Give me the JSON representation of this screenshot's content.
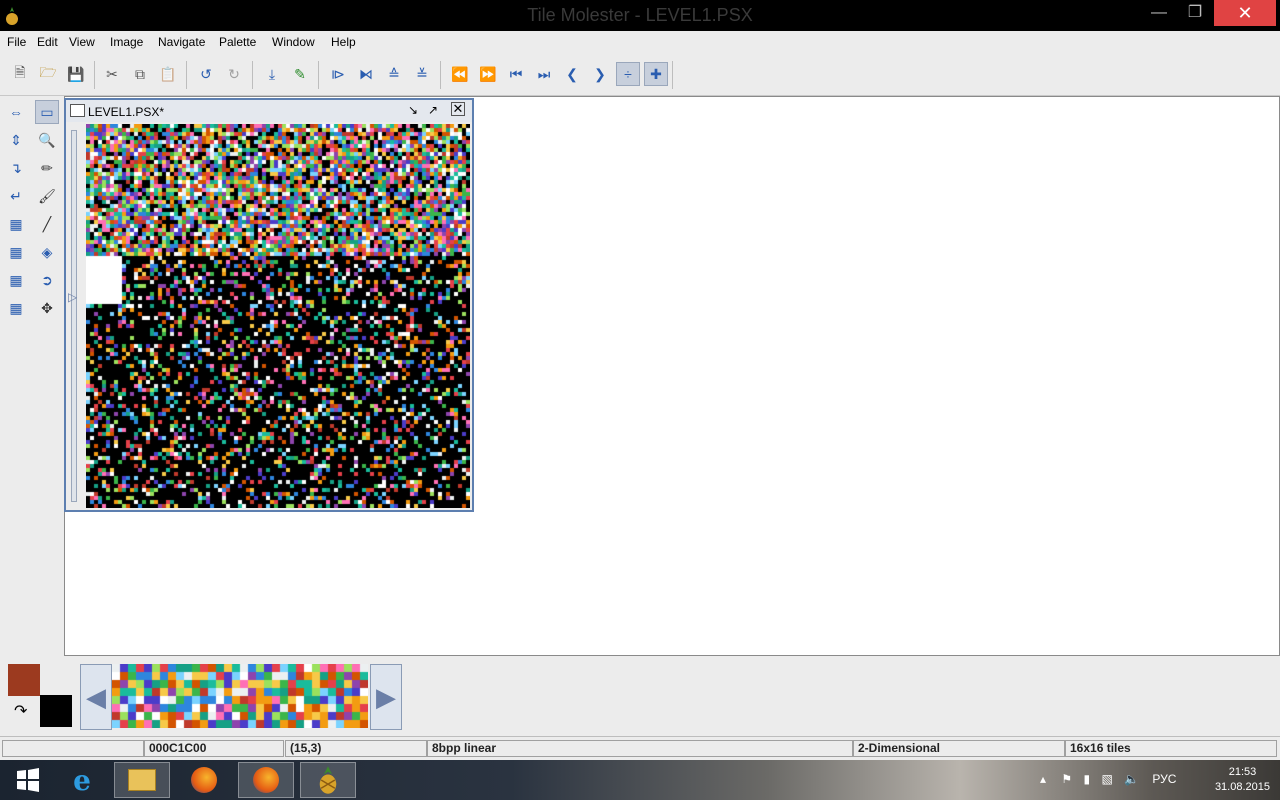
{
  "window": {
    "title": "Tile Molester - LEVEL1.PSX",
    "min_icon": "minimize-icon",
    "max_icon": "maximize-icon",
    "close_icon": "close-icon"
  },
  "menu": [
    "File",
    "Edit",
    "View",
    "Image",
    "Navigate",
    "Palette",
    "Window",
    "Help"
  ],
  "toolbar": {
    "icons": [
      "new-file-icon",
      "open-folder-icon",
      "save-icon",
      "cut-icon",
      "copy-icon",
      "paste-icon",
      "undo-icon",
      "redo-icon",
      "go-to-icon",
      "add-bookmark-icon",
      "decrease-width-icon",
      "increase-width-icon",
      "decrease-height-icon",
      "increase-height-icon",
      "page-back-icon",
      "page-forward-icon",
      "row-back-icon",
      "row-forward-icon",
      "tile-back-icon",
      "tile-forward-icon",
      "byte-back-icon",
      "byte-forward-icon"
    ]
  },
  "tools": {
    "left_column": [
      "scroll-horizontal-icon",
      "scroll-vertical-icon",
      "wrap-right-icon",
      "wrap-left-icon",
      "shift-left-icon",
      "shift-right-icon",
      "shift-up-icon",
      "shift-down-icon"
    ],
    "right_column": [
      "selection-icon",
      "zoom-icon",
      "dropper-icon",
      "brush-icon",
      "line-icon",
      "fill-icon",
      "replace-icon",
      "move-icon"
    ]
  },
  "document": {
    "title": "LEVEL1.PSX*"
  },
  "palette": {
    "foreground": "#9c3a1f",
    "background": "#000000",
    "swap_icon": "swap-colors-icon",
    "prev_icon": "palette-prev-icon",
    "next_icon": "palette-next-icon"
  },
  "status": {
    "blank": "",
    "offset": "000C1C00",
    "coords": "(15,3)",
    "codec": "8bpp linear",
    "mode": "2-Dimensional",
    "tiles": "16x16 tiles"
  },
  "taskbar": {
    "time": "21:53",
    "date": "31.08.2015",
    "lang": "РУС"
  }
}
